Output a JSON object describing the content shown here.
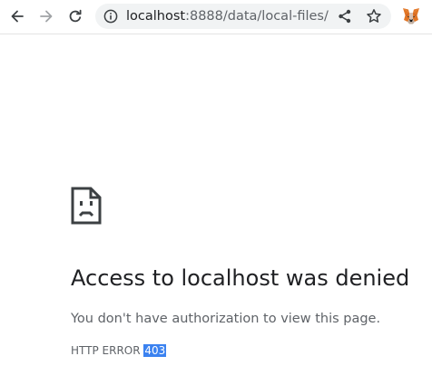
{
  "toolbar": {
    "back_icon": "arrow-left-icon",
    "forward_icon": "arrow-right-icon",
    "reload_icon": "reload-icon",
    "omnibox": {
      "info_icon": "info-icon",
      "url_host": "localhost",
      "url_rest": ":8888/data/local-files/",
      "share_icon": "share-icon",
      "bookmark_icon": "star-icon"
    },
    "extension_icon": "metamask-fox-icon"
  },
  "error_page": {
    "icon": "sad-document-icon",
    "title": "Access to localhost was denied",
    "description": "You don't have authorization to view this page.",
    "code_prefix": "HTTP ERROR",
    "code_number": "403"
  },
  "colors": {
    "title": "#202124",
    "secondary_text": "#5f6368",
    "selection": "#3b82f0",
    "omnibox_bg": "#f1f3f4"
  }
}
